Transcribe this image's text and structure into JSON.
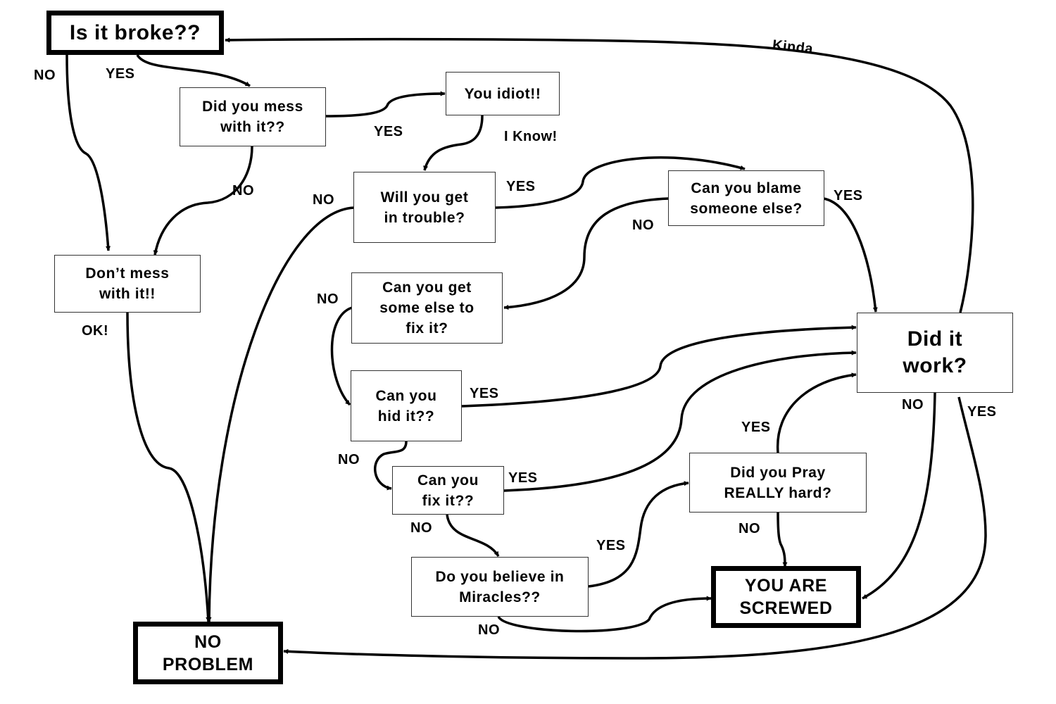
{
  "diagram": {
    "type": "flowchart",
    "colors": {
      "line": "#000000",
      "box_border": "#333333",
      "background": "#ffffff"
    },
    "nodes": {
      "is_it_broke": "Is it broke??",
      "did_you_mess": "Did you mess\nwith it??",
      "you_idiot": "You idiot!!",
      "dont_mess": "Don’t mess\nwith it!!",
      "will_you_get_in_trouble": "Will you get\nin trouble?",
      "can_you_blame": "Can you blame\nsomeone else?",
      "can_you_get_someone": "Can you get\nsome else to\nfix it?",
      "can_you_hide": "Can you\nhid it??",
      "can_you_fix": "Can you\nfix it??",
      "believe_in_miracles": "Do you believe in\nMiracles??",
      "pray": "Did you Pray\nREALLY hard?",
      "did_it_work": "Did it\nwork?",
      "you_are_screwed": "YOU ARE\nSCREWED",
      "no_problem": "NO\nPROBLEM"
    },
    "edge_labels": {
      "broke_no": "NO",
      "broke_yes": "YES",
      "mess_yes": "YES",
      "mess_no": "NO",
      "idiot_i_know": "I Know!",
      "dont_mess_ok": "OK!",
      "trouble_no": "NO",
      "trouble_yes": "YES",
      "blame_yes": "YES",
      "blame_no": "NO",
      "someone_no": "NO",
      "hide_yes": "YES",
      "hide_no": "NO",
      "fix_yes": "YES",
      "fix_no": "NO",
      "miracles_yes": "YES",
      "miracles_no": "NO",
      "pray_yes": "YES",
      "pray_no": "NO",
      "work_no": "NO",
      "work_yes": "YES",
      "work_kinda": "Kinda"
    },
    "edges": [
      {
        "from": "is_it_broke",
        "to": "dont_mess",
        "label": "NO"
      },
      {
        "from": "is_it_broke",
        "to": "did_you_mess",
        "label": "YES"
      },
      {
        "from": "did_you_mess",
        "to": "you_idiot",
        "label": "YES"
      },
      {
        "from": "did_you_mess",
        "to": "dont_mess",
        "label": "NO"
      },
      {
        "from": "you_idiot",
        "to": "will_you_get_in_trouble",
        "label": "I Know!"
      },
      {
        "from": "dont_mess",
        "to": "no_problem",
        "label": "OK!"
      },
      {
        "from": "will_you_get_in_trouble",
        "to": "no_problem",
        "label": "NO"
      },
      {
        "from": "will_you_get_in_trouble",
        "to": "can_you_blame",
        "label": "YES"
      },
      {
        "from": "can_you_blame",
        "to": "did_it_work",
        "label": "YES"
      },
      {
        "from": "can_you_blame",
        "to": "can_you_get_someone",
        "label": "NO"
      },
      {
        "from": "can_you_get_someone",
        "to": "can_you_hide",
        "label": "NO"
      },
      {
        "from": "can_you_hide",
        "to": "did_it_work",
        "label": "YES"
      },
      {
        "from": "can_you_hide",
        "to": "can_you_fix",
        "label": "NO"
      },
      {
        "from": "can_you_fix",
        "to": "did_it_work",
        "label": "YES"
      },
      {
        "from": "can_you_fix",
        "to": "believe_in_miracles",
        "label": "NO"
      },
      {
        "from": "believe_in_miracles",
        "to": "pray",
        "label": "YES"
      },
      {
        "from": "believe_in_miracles",
        "to": "you_are_screwed",
        "label": "NO"
      },
      {
        "from": "pray",
        "to": "did_it_work",
        "label": "YES"
      },
      {
        "from": "pray",
        "to": "you_are_screwed",
        "label": "NO"
      },
      {
        "from": "did_it_work",
        "to": "you_are_screwed",
        "label": "NO"
      },
      {
        "from": "did_it_work",
        "to": "no_problem",
        "label": "YES"
      },
      {
        "from": "did_it_work",
        "to": "is_it_broke",
        "label": "Kinda"
      }
    ]
  }
}
